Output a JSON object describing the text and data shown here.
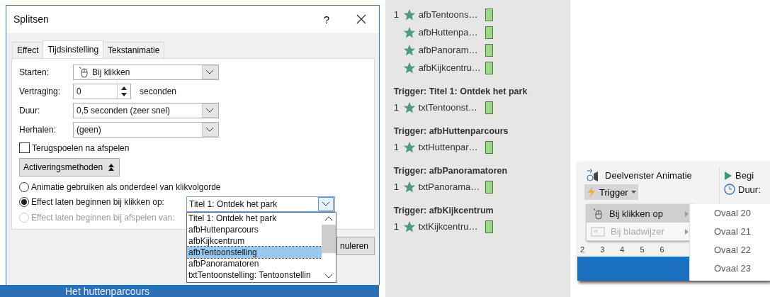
{
  "dialog": {
    "title": "Splitsen",
    "help": "?",
    "tabs": [
      {
        "label": "Effect",
        "selected": false
      },
      {
        "label": "Tijdsinstelling",
        "selected": true
      },
      {
        "label": "Tekstanimatie",
        "selected": false
      }
    ],
    "fields": [
      {
        "label": "Starten:",
        "kind": "click-dropdown",
        "value": "Bij klikken"
      },
      {
        "label": "Vertraging:",
        "kind": "spinner",
        "value": "0",
        "unit": "seconden"
      },
      {
        "label": "Duur:",
        "kind": "dropdown",
        "value": "0,5 seconden (zeer snel)"
      },
      {
        "label": "Herhalen:",
        "kind": "dropdown",
        "value": "(geen)"
      }
    ],
    "rewind": {
      "label": "Terugspoelen na afspelen",
      "checked": false
    },
    "triggers_button": {
      "label": "Activeringsmethoden",
      "expanded": true
    },
    "radios": [
      {
        "label": "Animatie gebruiken als onderdeel van klikvolgorde",
        "selected": false,
        "disabled": false
      },
      {
        "label": "Effect laten beginnen bij klikken op:",
        "selected": true,
        "disabled": false
      },
      {
        "label": "Effect laten beginnen bij afspelen van:",
        "selected": false,
        "disabled": true
      }
    ],
    "trigger_select": {
      "value": "Titel 1: Ontdek het park",
      "expanded": true,
      "options": [
        {
          "label": "Titel 1: Ontdek het park",
          "highlighted": false
        },
        {
          "label": "afbHuttenparcours",
          "highlighted": false
        },
        {
          "label": "afbKijkcentrum",
          "highlighted": false
        },
        {
          "label": "afbTentoonstelling",
          "highlighted": true
        },
        {
          "label": "afbPanoramatoren",
          "highlighted": false
        },
        {
          "label": "txtTentoonstelling: Tentoonstellin",
          "highlighted": false
        }
      ]
    },
    "cancel_button": "nuleren",
    "slide_text": "Het huttenparcours"
  },
  "animation_pane": {
    "groups": [
      {
        "items": [
          {
            "number": "1",
            "name": "afbTentoons…"
          },
          {
            "name": "afbHuttenpa…"
          },
          {
            "name": "afbPanoram…"
          },
          {
            "name": "afbKijkcentru…"
          }
        ]
      },
      {
        "header": "Trigger: Titel 1: Ontdek het park",
        "items": [
          {
            "number": "1",
            "name": "txtTentoonst…"
          }
        ]
      },
      {
        "header": "Trigger: afbHuttenparcours",
        "items": [
          {
            "number": "1",
            "name": "txtHuttenpar…"
          }
        ]
      },
      {
        "header": "Trigger: afbPanoramatoren",
        "items": [
          {
            "number": "1",
            "name": "txtPanorama…"
          }
        ]
      },
      {
        "header": "Trigger: afbKijkcentrum",
        "items": [
          {
            "number": "1",
            "name": "txtKijkcentru…"
          }
        ]
      }
    ]
  },
  "ribbon": {
    "pane_button": "Deelvenster Animatie",
    "trigger_button": {
      "label": "Trigger",
      "expanded": true
    },
    "start_label": "Begi",
    "duration_label": "Duur:",
    "menu": [
      {
        "label": "Bij klikken op",
        "selected": true,
        "disabled": false
      },
      {
        "label": "Bij bladwijzer",
        "selected": false,
        "disabled": true
      }
    ],
    "submenu": [
      "Ovaal 20",
      "Ovaal 21",
      "Ovaal 22",
      "Ovaal 23"
    ],
    "ruler": [
      "2",
      "3",
      "4",
      "5",
      "6"
    ]
  }
}
